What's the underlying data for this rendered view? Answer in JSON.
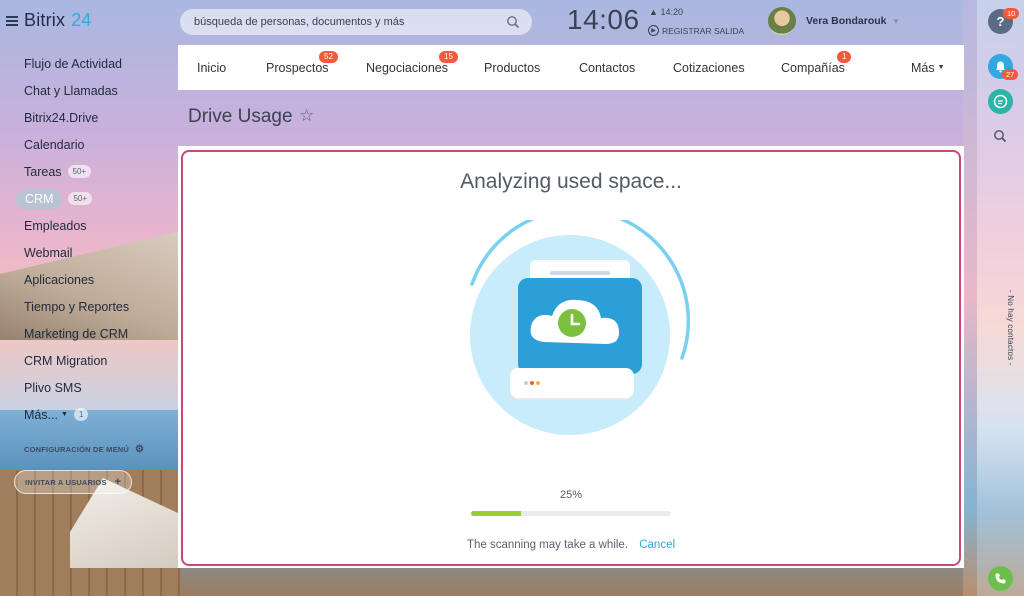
{
  "app": {
    "brand": "Bitrix",
    "brand_num": "24"
  },
  "sidebar": {
    "items": [
      {
        "label": "Flujo de Actividad"
      },
      {
        "label": "Chat y Llamadas"
      },
      {
        "label": "Bitrix24.Drive"
      },
      {
        "label": "Calendario"
      },
      {
        "label": "Tareas",
        "badge": "50+"
      },
      {
        "label": "CRM",
        "badge": "50+"
      },
      {
        "label": "Empleados"
      },
      {
        "label": "Webmail"
      },
      {
        "label": "Aplicaciones"
      },
      {
        "label": "Tiempo y Reportes"
      },
      {
        "label": "Marketing de CRM"
      },
      {
        "label": "CRM Migration"
      },
      {
        "label": "Plivo SMS"
      },
      {
        "label": "Más...",
        "badge": "1"
      }
    ],
    "config_label": "CONFIGURACIÓN DE MENÚ",
    "invite_label": "INVITAR A USUARIOS"
  },
  "header": {
    "search_placeholder": "búsqueda de personas, documentos y más",
    "time": "14:06",
    "alarm_time": "14:20",
    "checkout_label": "REGISTRAR SALIDA",
    "user_name": "Vera Bondarouk"
  },
  "menu": {
    "items": [
      {
        "label": "Inicio"
      },
      {
        "label": "Prospectos",
        "badge": "52"
      },
      {
        "label": "Negociaciones",
        "badge": "15"
      },
      {
        "label": "Productos"
      },
      {
        "label": "Contactos"
      },
      {
        "label": "Cotizaciones"
      },
      {
        "label": "Compañías",
        "badge": "1"
      },
      {
        "label": "Más"
      }
    ]
  },
  "page": {
    "title": "Drive Usage",
    "heading": "Analyzing used space...",
    "progress_percent": 25,
    "progress_label": "25%",
    "note": "The scanning may take a while.",
    "cancel_label": "Cancel"
  },
  "rail": {
    "help_badge": "10",
    "bell_badge": "27",
    "no_contacts": "- No hay contactos -"
  },
  "colors": {
    "accent": "#2fa9df",
    "badge": "#f35a3b",
    "progress": "#9acd32",
    "card_border": "#c94779"
  }
}
